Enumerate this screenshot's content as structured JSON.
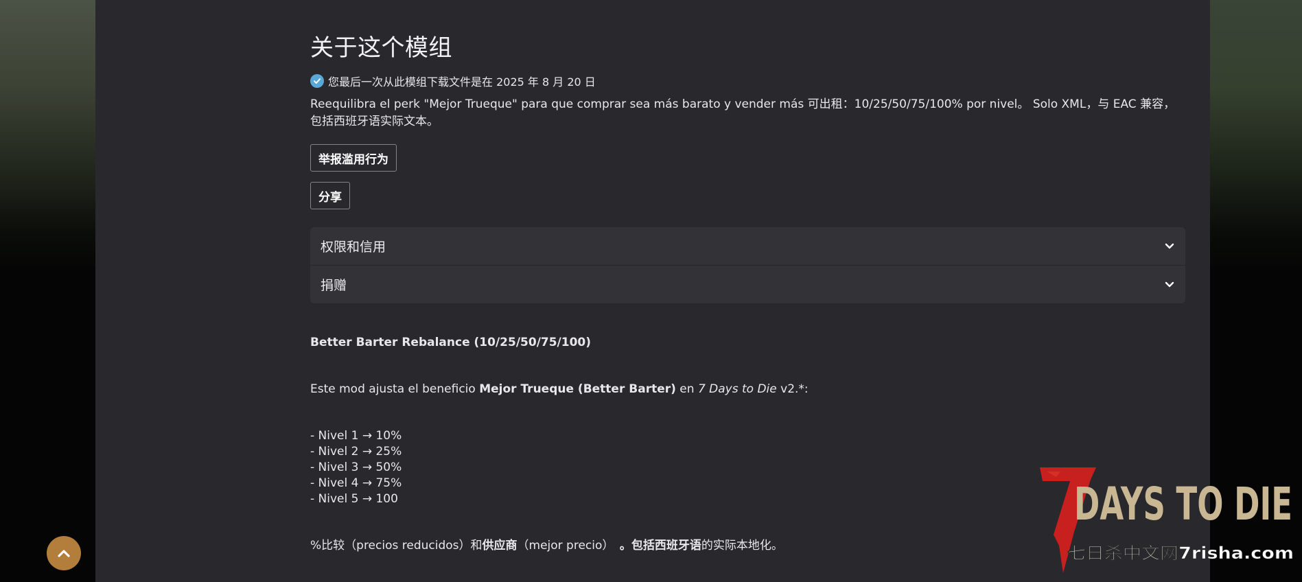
{
  "about": {
    "title": "关于这个模组",
    "download_notice": "您最后一次从此模组下载文件是在 2025 年 8 月 20 日",
    "summary": "Reequilibra el perk \"Mejor Trueque\" para que comprar sea más barato y vender más 可出租：10/25/50/75/100% por nivel。 Solo XML，与 EAC 兼容，包括西班牙语实际文本。",
    "report_label": "举报滥用行为",
    "share_label": "分享"
  },
  "accordion": {
    "items": [
      {
        "label": "权限和信用"
      },
      {
        "label": "捐赠"
      }
    ]
  },
  "description": {
    "heading": "Better Barter Rebalance (10/25/50/75/100)",
    "intro_pre": "Este mod ajusta el beneficio ",
    "intro_bold": "Mejor Trueque (Better Barter)",
    "intro_mid": " en ",
    "intro_italic": "7 Days to Die",
    "intro_post": " v2.*:",
    "levels": [
      "- Nivel 1 → 10%",
      "- Nivel 2 → 25%",
      "- Nivel 3 → 50%",
      "- Nivel 4 → 75%",
      "- Nivel 5 → 100"
    ],
    "footer_a": "%比较（precios reducidos）和",
    "footer_b": "供应商",
    "footer_c": "（mejor precio）　",
    "footer_d": "。包括西班牙语",
    "footer_e": "的实际本地化。"
  },
  "watermark": {
    "logo_text": "DAYS TO DIE",
    "logo_numeral": "7",
    "site_text": "七日杀中文网7risha.com"
  },
  "icons": {
    "check": "check-circle-icon",
    "chevron": "chevron-down-icon",
    "scroll_top": "chevron-up-icon"
  },
  "colors": {
    "panel": "#29282d",
    "accordion": "#333237",
    "check": "#5aa8d8",
    "scroll_button": "#b37d3b",
    "logo_red": "#c81f1f",
    "logo_tan": "#c9b793"
  }
}
